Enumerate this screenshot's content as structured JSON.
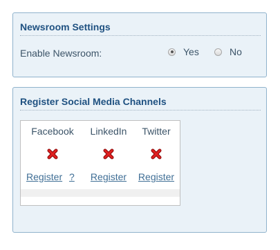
{
  "newsroom": {
    "title": "Newsroom Settings",
    "enable_label": "Enable Newsroom:",
    "options": [
      {
        "label": "Yes",
        "selected": true
      },
      {
        "label": "No",
        "selected": false
      }
    ]
  },
  "social": {
    "title": "Register Social Media Channels",
    "channels": [
      {
        "name": "Facebook",
        "status_icon": "x-icon",
        "action": "Register",
        "help": "?"
      },
      {
        "name": "LinkedIn",
        "status_icon": "x-icon",
        "action": "Register"
      },
      {
        "name": "Twitter",
        "status_icon": "x-icon",
        "action": "Register"
      }
    ]
  },
  "colors": {
    "panel_bg": "#eaf2f8",
    "title": "#1f5181",
    "link": "#3f6e95",
    "x_icon": "#cc1111"
  }
}
